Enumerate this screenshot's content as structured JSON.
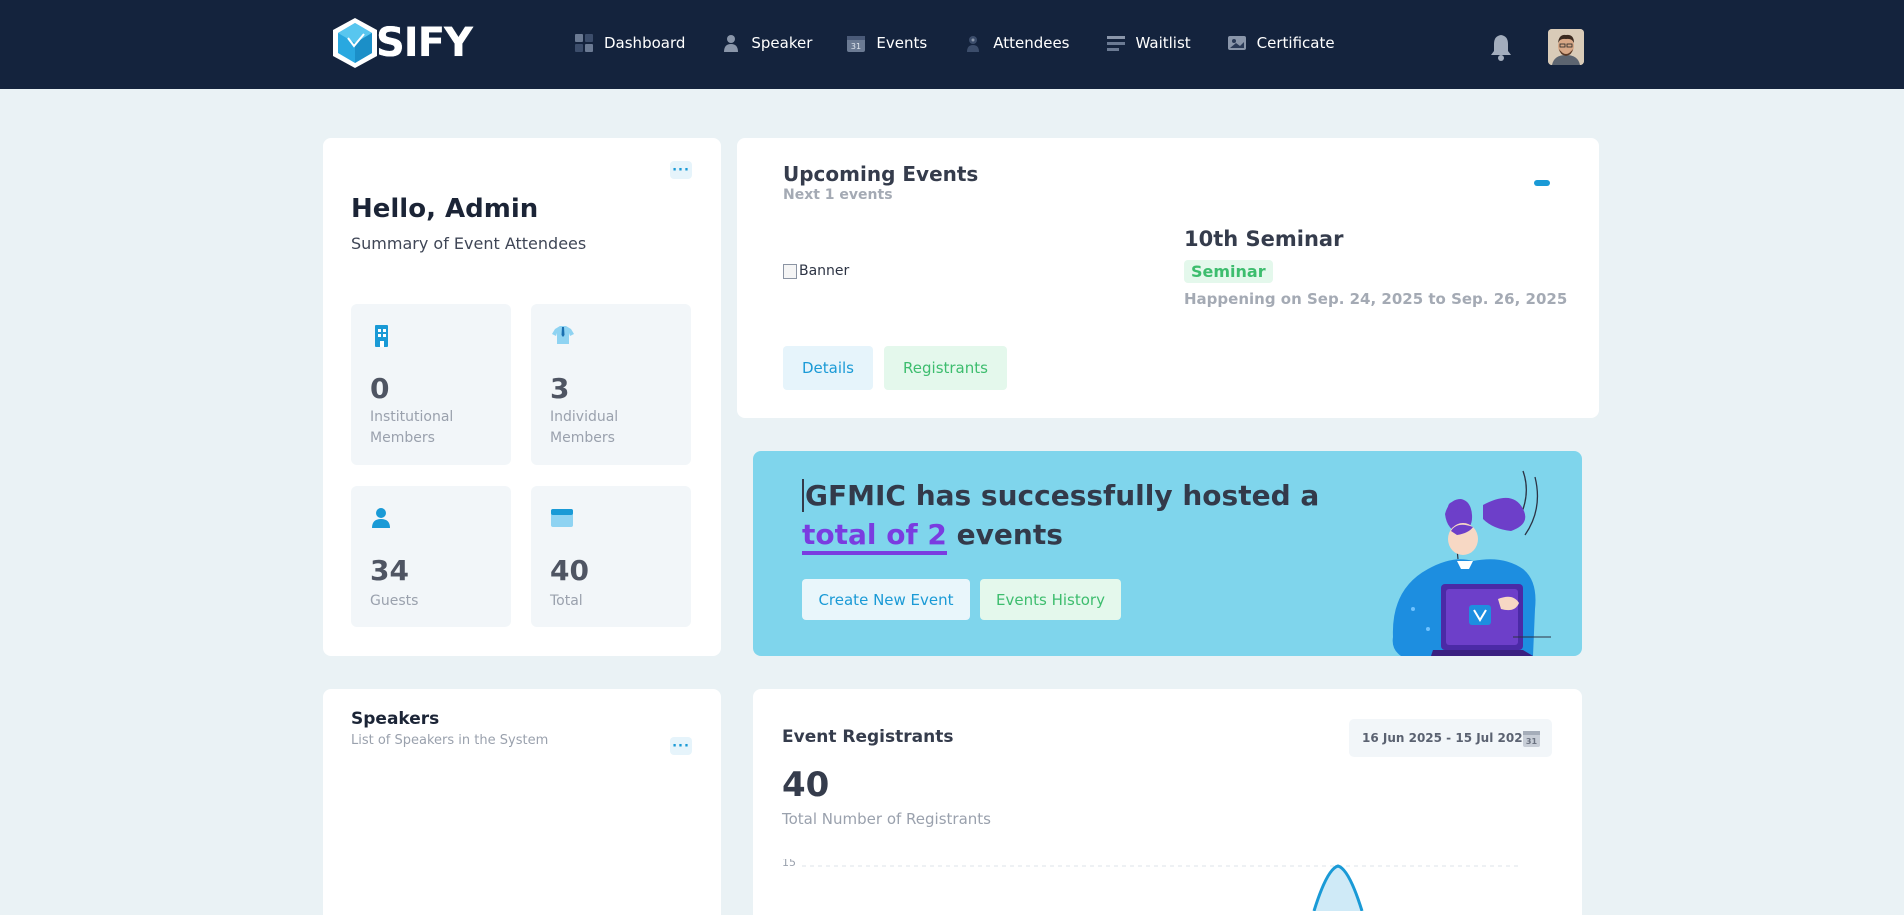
{
  "header": {
    "logo_text": "SIFY",
    "nav": [
      {
        "label": "Dashboard",
        "icon": "dashboard-icon"
      },
      {
        "label": "Speaker",
        "icon": "user-icon"
      },
      {
        "label": "Events",
        "icon": "calendar-icon"
      },
      {
        "label": "Attendees",
        "icon": "attendees-icon"
      },
      {
        "label": "Waitlist",
        "icon": "list-icon"
      },
      {
        "label": "Certificate",
        "icon": "image-icon"
      }
    ],
    "notifications_icon": "bell-icon",
    "avatar_icon": "user-avatar"
  },
  "summary": {
    "title": "Hello, Admin",
    "subtitle": "Summary of Event Attendees",
    "menu_label": "···",
    "stats": [
      {
        "value": "0",
        "label": "Institutional Members",
        "icon": "building-icon"
      },
      {
        "value": "3",
        "label": "Individual Members",
        "icon": "shirt-icon"
      },
      {
        "value": "34",
        "label": "Guests",
        "icon": "person-icon"
      },
      {
        "value": "40",
        "label": "Total",
        "icon": "card-icon"
      }
    ]
  },
  "upcoming": {
    "title": "Upcoming Events",
    "subtitle": "Next 1 events",
    "banner_alt": "Banner",
    "event": {
      "name": "10th Seminar",
      "type": "Seminar",
      "date": "Happening on Sep. 24, 2025 to Sep. 26, 2025"
    },
    "details_label": "Details",
    "registrants_label": "Registrants"
  },
  "promo": {
    "line1": "GFMIC has successfully hosted a",
    "highlight": "total of 2",
    "line2_rest": " events",
    "create_label": "Create New Event",
    "history_label": "Events History"
  },
  "speakers": {
    "title": "Speakers",
    "subtitle": "List of Speakers in the System",
    "menu_label": "···"
  },
  "registrants": {
    "title": "Event Registrants",
    "date_range": "16 Jun 2025 - 15 Jul 2025",
    "total": "40",
    "total_label": "Total Number of Registrants"
  },
  "chart_data": {
    "type": "area",
    "title": "",
    "y_ticks": [
      "15"
    ],
    "series": [
      {
        "values": []
      }
    ]
  },
  "colors": {
    "header_bg": "#14233d",
    "page_bg": "#eaf2f5",
    "primary": "#1a9ad6",
    "success": "#3dbd6e",
    "promo_bg": "#7fd5ec",
    "highlight": "#7a3ce0"
  }
}
